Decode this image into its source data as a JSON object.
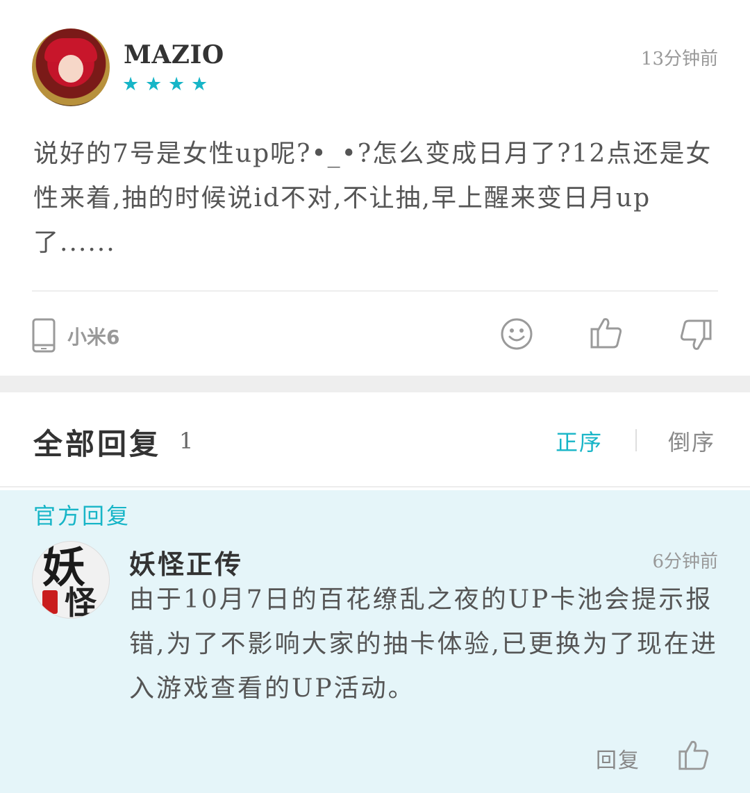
{
  "comment": {
    "username": "MAZIO",
    "rating": 4,
    "stars": [
      "★",
      "★",
      "★",
      "★"
    ],
    "time": "13分钟前",
    "content": "说好的7号是女性up呢?•_•?怎么变成日月了?12点还是女性来着,抽的时候说id不对,不让抽,早上醒来变日月up了......",
    "device": "小米6",
    "icons": {
      "device": "phone-icon",
      "emoji": "smile-icon",
      "like": "thumbs-up-icon",
      "dislike": "thumbs-down-icon"
    }
  },
  "replies": {
    "title": "全部回复",
    "count": "1",
    "sort_asc": "正序",
    "sort_desc": "倒序"
  },
  "official_reply": {
    "label": "官方回复",
    "username": "妖怪正传",
    "time": "6分钟前",
    "content": "由于10月7日的百花缭乱之夜的UP卡池会提示报错,为了不影响大家的抽卡体验,已更换为了现在进入游戏查看的UP活动。",
    "reply_label": "回复",
    "avatar_glyphs": {
      "main": "妖",
      "sub": "怪"
    }
  },
  "colors": {
    "accent": "#17b5c7",
    "official_bg": "#e5f5f9",
    "divider": "#eeeeee"
  }
}
